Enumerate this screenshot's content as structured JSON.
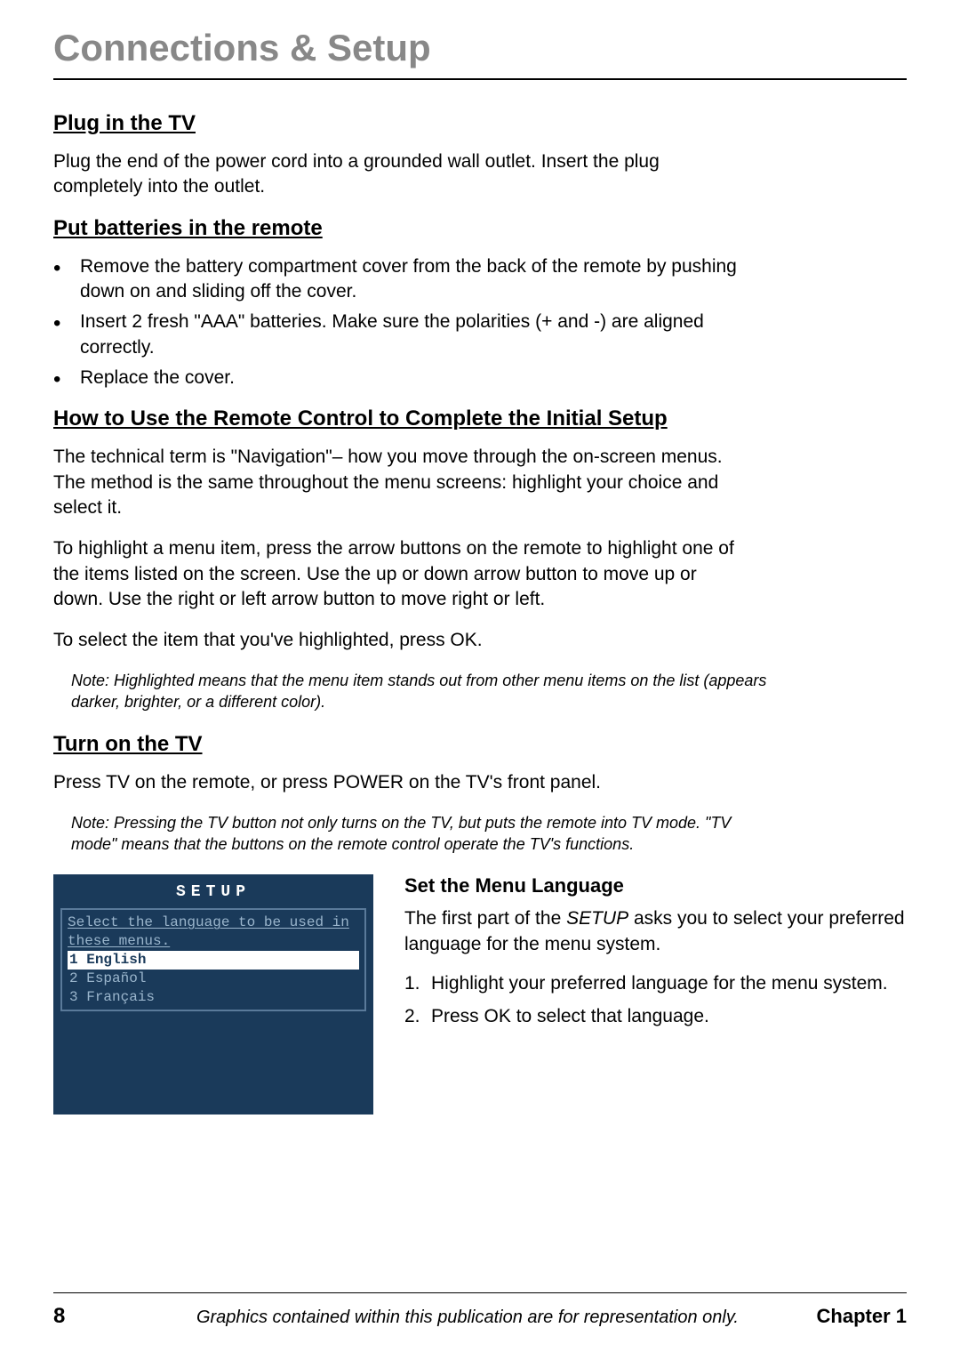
{
  "page_title": "Connections & Setup",
  "sections": {
    "plug": {
      "heading": "Plug in the TV",
      "text": "Plug the end of the power cord into a grounded wall outlet. Insert the plug completely into the outlet."
    },
    "batteries": {
      "heading": "Put batteries in the remote",
      "items": [
        "Remove the battery compartment cover from the back of the remote by pushing down on and sliding off the cover.",
        "Insert 2 fresh \"AAA\" batteries. Make sure the polarities (+ and -) are aligned correctly.",
        "Replace the cover."
      ]
    },
    "remote_setup": {
      "heading": "How to Use the Remote Control to Complete the Initial Setup",
      "p1": "The technical term is \"Navigation\"– how you move through the on-screen menus. The method is the same throughout the menu screens: highlight your choice and select it.",
      "p2": "To highlight a menu item, press the arrow buttons on the remote to highlight one of the items listed on the screen. Use the up or down arrow button to move up or down. Use the right or left arrow button to move right or left.",
      "p3": "To select the item that you've highlighted, press OK.",
      "note": "Note: Highlighted means that the menu item stands out from other menu items on the list (appears darker, brighter, or a different color)."
    },
    "turn_on": {
      "heading": "Turn on the TV",
      "text": "Press TV on the remote, or press POWER on the TV's front panel.",
      "note": "Note: Pressing the TV button not only turns on the TV, but puts the remote into TV mode. \"TV mode\" means that the buttons on the remote control operate the TV's functions."
    },
    "menu_language": {
      "heading": "Set the Menu Language",
      "intro_pre": "The first part of the ",
      "intro_em": "SETUP",
      "intro_post": " asks you to select your preferred language for the menu system.",
      "steps": [
        "Highlight your preferred language for the menu system.",
        "Press OK to select that language."
      ]
    }
  },
  "setup_screen": {
    "title": "SETUP",
    "instruction": "Select the language to be used in these menus.",
    "options": [
      {
        "num": "1",
        "label": "English",
        "selected": true
      },
      {
        "num": "2",
        "label": "Español",
        "selected": false
      },
      {
        "num": "3",
        "label": "Français",
        "selected": false
      }
    ]
  },
  "footer": {
    "page": "8",
    "caption": "Graphics contained within this publication are for representation only.",
    "chapter": "Chapter 1"
  }
}
